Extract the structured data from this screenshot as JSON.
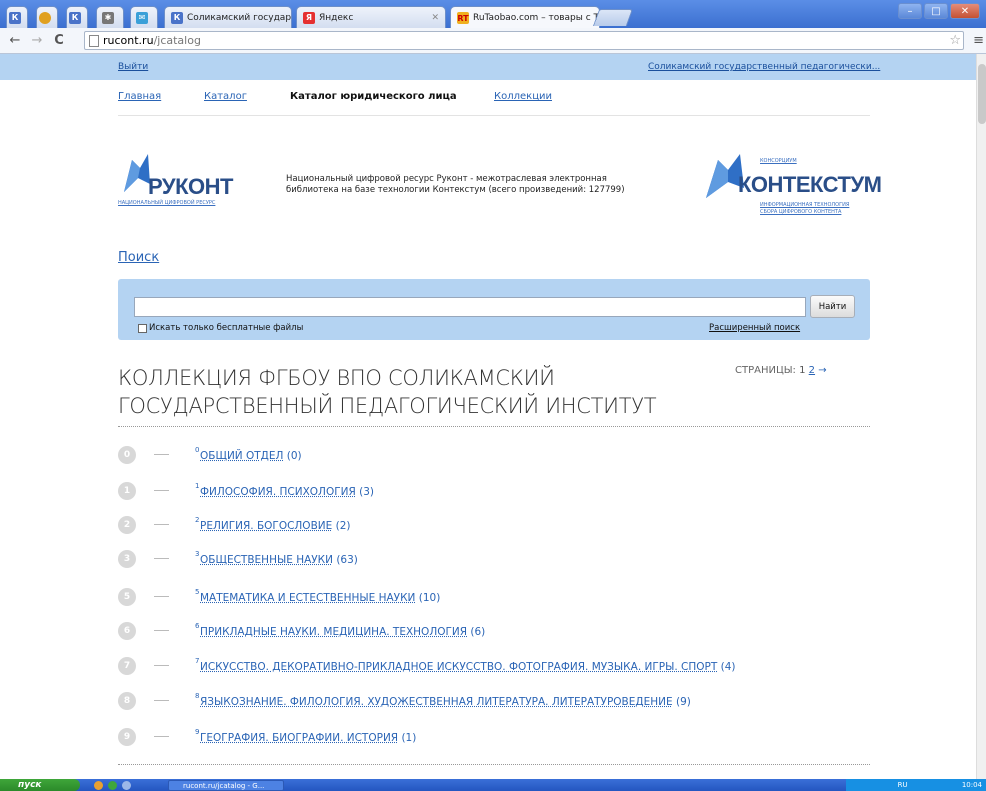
{
  "browser": {
    "tabs": [
      {
        "label": "",
        "icon": "k-icon"
      },
      {
        "label": "",
        "icon": "chrome-icon"
      },
      {
        "label": "",
        "icon": "k-icon"
      },
      {
        "label": "",
        "icon": "puzzle-icon"
      },
      {
        "label": "",
        "icon": "chat-icon"
      },
      {
        "label": "Соликамский государствен",
        "icon": "k-icon"
      },
      {
        "label": "Яндекс",
        "icon": "yandex-icon"
      },
      {
        "label": "RuTaobao.com – товары с Т.",
        "icon": "rt-icon"
      }
    ],
    "url_host": "rucont.ru",
    "url_path": "/jcatalog"
  },
  "sitebar": {
    "logout": "Выйти",
    "org": "Соликамский государственный педагогически..."
  },
  "nav": {
    "home": "Главная",
    "catalog": "Каталог",
    "legal_catalog": "Каталог юридического лица",
    "collections": "Коллекции"
  },
  "header": {
    "rukont_word": "РУКОНТ",
    "rukont_sub": "НАЦИОНАЛЬНЫЙ ЦИФРОВОЙ РЕСУРС",
    "description": "Национальный цифровой ресурс Руконт - межотраслевая электронная библиотека на базе технологии Контекстум (всего произведений: 127799)",
    "kontext_top": "КОНСОРЦИУМ",
    "kontext_word": "КОНТЕКСТУМ",
    "kontext_sub1": "ИНФОРМАЦИОННАЯ ТЕХНОЛОГИЯ",
    "kontext_sub2": "СБОРА ЦИФРОВОГО КОНТЕНТА"
  },
  "search": {
    "title": "Поиск",
    "value": "",
    "button": "Найти",
    "free_only": "Искать только бесплатные файлы",
    "advanced": "Расширенный поиск"
  },
  "collection": {
    "title": "КОЛЛЕКЦИЯ ФГБОУ ВПО СОЛИКАМСКИЙ ГОСУДАРСТВЕННЫЙ ПЕДАГОГИЧЕСКИЙ ИНСТИТУТ",
    "pages_label": "СТРАНИЦЫ:",
    "page1": "1",
    "page2": "2",
    "next": "→",
    "categories": [
      {
        "num": "0",
        "sup": "0",
        "name": "ОБЩИЙ ОТДЕЛ",
        "count": "(0)"
      },
      {
        "num": "1",
        "sup": "1",
        "name": "ФИЛОСОФИЯ. ПСИХОЛОГИЯ",
        "count": "(3)"
      },
      {
        "num": "2",
        "sup": "2",
        "name": "РЕЛИГИЯ. БОГОСЛОВИЕ",
        "count": "(2)"
      },
      {
        "num": "3",
        "sup": "3",
        "name": "ОБЩЕСТВЕННЫЕ НАУКИ",
        "count": "(63)"
      },
      {
        "num": "5",
        "sup": "5",
        "name": "МАТЕМАТИКА И ЕСТЕСТВЕННЫЕ НАУКИ",
        "count": "(10)"
      },
      {
        "num": "6",
        "sup": "6",
        "name": "ПРИКЛАДНЫЕ НАУКИ. МЕДИЦИНА. ТЕХНОЛОГИЯ",
        "count": "(6)"
      },
      {
        "num": "7",
        "sup": "7",
        "name": "ИСКУССТВО. ДЕКОРАТИВНО-ПРИКЛАДНОЕ ИСКУССТВО. ФОТОГРАФИЯ. МУЗЫКА. ИГРЫ. СПОРТ",
        "count": "(4)"
      },
      {
        "num": "8",
        "sup": "8",
        "name": "ЯЗЫКОЗНАНИЕ. ФИЛОЛОГИЯ. ХУДОЖЕСТВЕННАЯ ЛИТЕРАТУРА. ЛИТЕРАТУРОВЕДЕНИЕ",
        "count": "(9)"
      },
      {
        "num": "9",
        "sup": "9",
        "name": "ГЕОГРАФИЯ. БИОГРАФИИ. ИСТОРИЯ",
        "count": "(1)"
      }
    ]
  },
  "taskbar": {
    "start": "пуск",
    "task": "rucont.ru/jcatalog - G...",
    "tray": "RU",
    "clock": "10:04"
  },
  "colors": {
    "link": "#2a64b5",
    "band": "#b4d3f2"
  }
}
